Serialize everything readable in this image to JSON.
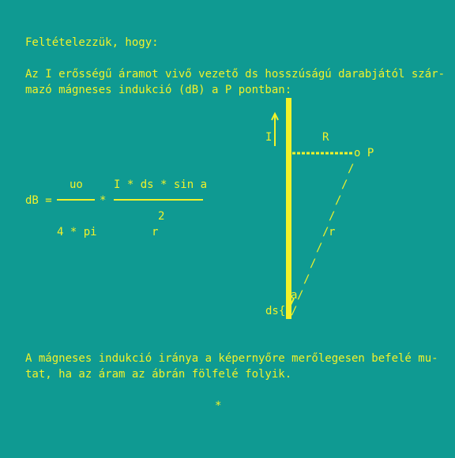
{
  "intro": {
    "heading": "Feltételezzük, hogy:",
    "line1": "Az I erősségű áramot vivő vezető ds hosszúságú darabjától szár-",
    "line2": "mazó mágneses indukció (dB) a P pontban:"
  },
  "formula": {
    "lhs": "dB =",
    "num1": "uo",
    "times": "*",
    "num2": "I * ds * sin a",
    "exp": "2",
    "den1": "4 * pi",
    "den2": "r"
  },
  "diagram": {
    "current_label": "I",
    "R_label": "R",
    "P_label": "o P",
    "r_label": "r",
    "angle_label": "a",
    "ds_label": "ds{"
  },
  "conclusion": {
    "line1": "A mágneses indukció iránya a képernyőre merőlegesen befelé mu-",
    "line2": "tat, ha az áram az ábrán fölfelé folyik."
  },
  "footer": {
    "marker": "*"
  }
}
